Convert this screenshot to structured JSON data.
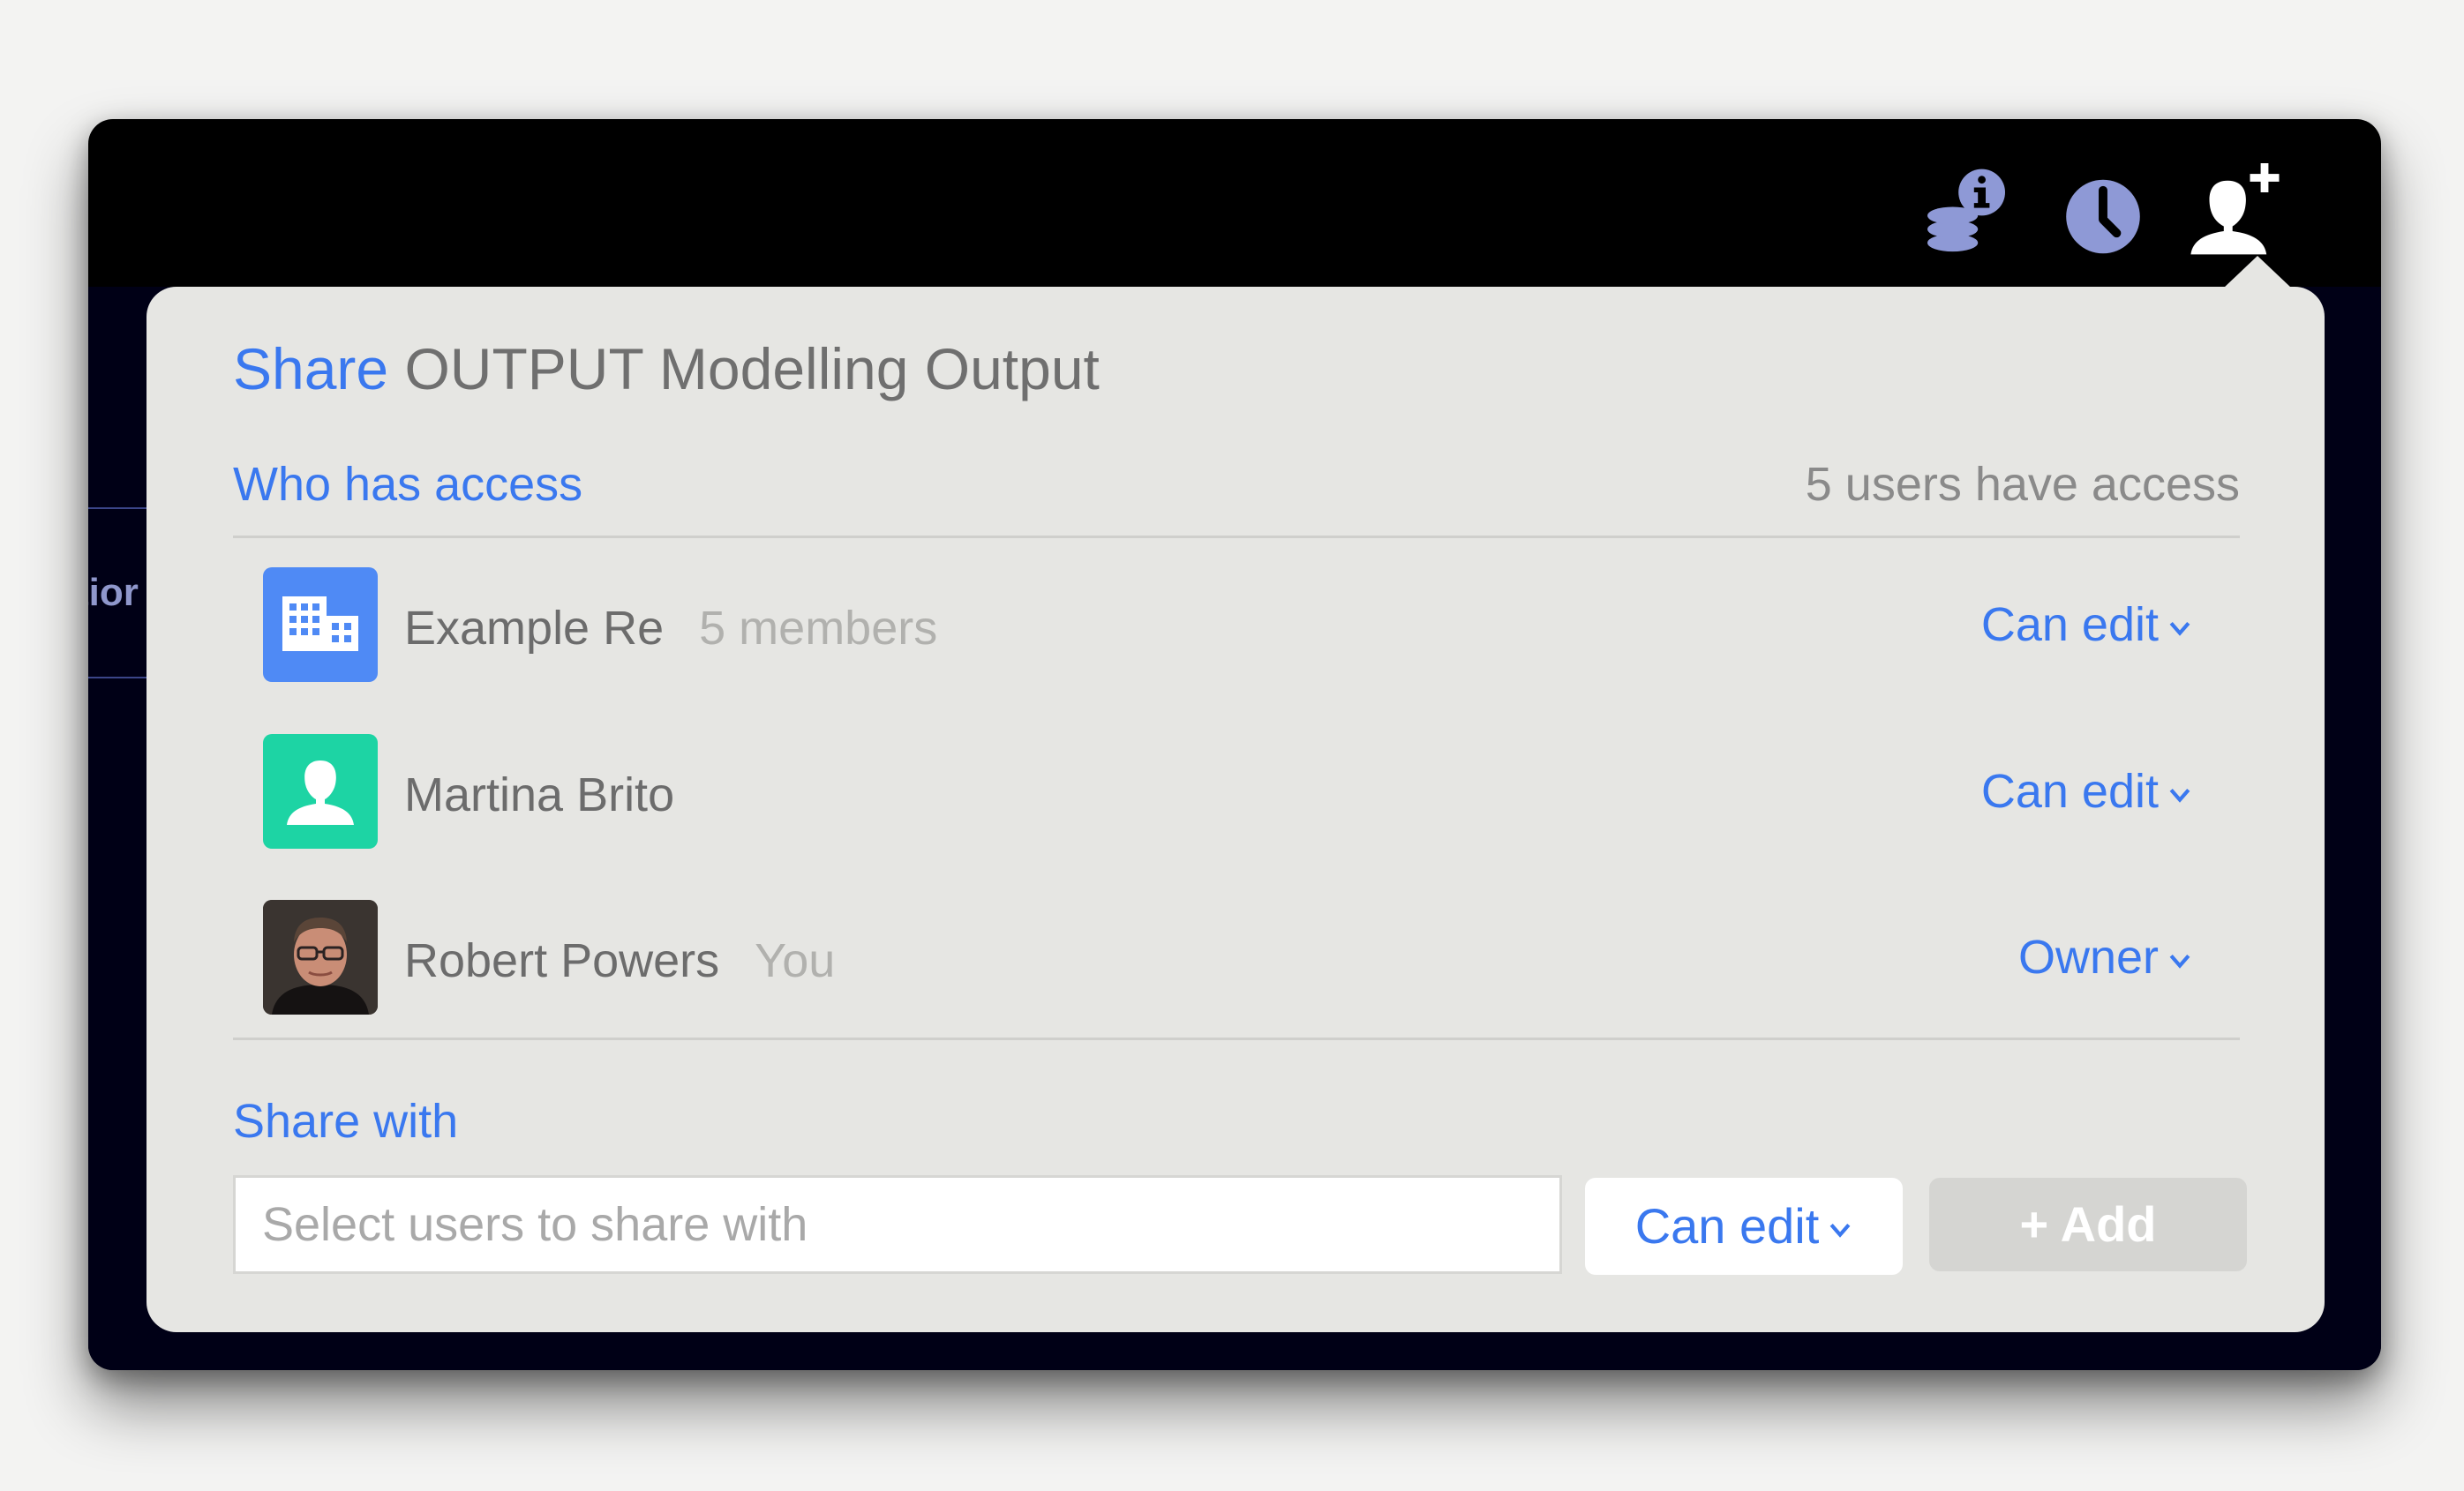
{
  "background": {
    "tab_fragment": "tior"
  },
  "toolbar": {
    "icons": [
      "coins-info-icon",
      "clock-icon",
      "add-user-icon"
    ]
  },
  "dialog": {
    "title_action": "Share",
    "title_object": "OUTPUT Modelling Output",
    "access_section_label": "Who has access",
    "access_count": "5 users have access",
    "members": [
      {
        "name": "Example Re",
        "detail": "5 members",
        "permission": "Can edit",
        "avatar": "building-icon"
      },
      {
        "name": "Martina Brito",
        "detail": "",
        "permission": "Can edit",
        "avatar": "user-icon"
      },
      {
        "name": "Robert Powers",
        "detail": "You",
        "permission": "Owner",
        "avatar": "user-photo"
      }
    ],
    "share_section_label": "Share with",
    "share_input_placeholder": "Select users to share with",
    "share_permission": "Can edit",
    "add_button": "+ Add"
  },
  "colors": {
    "accent": "#3a78ef",
    "org_avatar": "#4f8af5",
    "user_avatar": "#1dd4a4",
    "popover_bg": "#e6e6e3",
    "add_button_bg": "#d5d5d2"
  }
}
